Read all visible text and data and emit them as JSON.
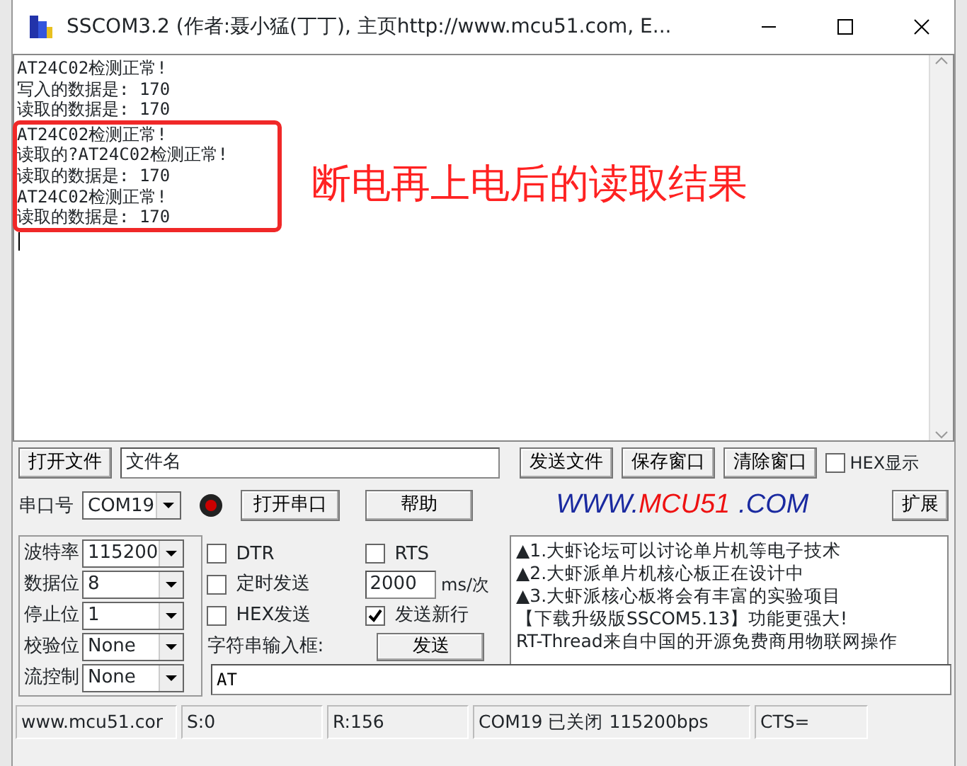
{
  "window": {
    "title": "SSCOM3.2 (作者:聂小猛(丁丁), 主页http://www.mcu51.com,  E..."
  },
  "receive_log": {
    "lines": [
      {
        "text": "AT24C02检测正常!",
        "highlighted": false
      },
      {
        "text": "写入的数据是: 170",
        "highlighted": false
      },
      {
        "text": "读取的数据是: 170",
        "highlighted": false
      },
      {
        "text": "AT24C02检测正常!",
        "highlighted": true
      },
      {
        "text": "读取的?AT24C02检测正常!",
        "highlighted": true
      },
      {
        "text": "读取的数据是: 170",
        "highlighted": true
      },
      {
        "text": "AT24C02检测正常!",
        "highlighted": true
      },
      {
        "text": "读取的数据是: 170",
        "highlighted": true
      }
    ]
  },
  "annotation": {
    "text": "断电再上电后的读取结果"
  },
  "file_row": {
    "open_file_button": "打开文件",
    "file_name": "文件名",
    "send_file_button": "发送文件",
    "save_window_button": "保存窗口",
    "clear_window_button": "清除窗口",
    "hex_display": {
      "label": "HEX显示",
      "checked": false
    }
  },
  "port_row": {
    "port_label": "串口号",
    "port": "COM19",
    "open_port_button": "打开串口",
    "help_button": "帮助",
    "logo": [
      "WWW.",
      "MCU51",
      ".COM"
    ],
    "expand_button": "扩展"
  },
  "settings": [
    {
      "label": "波特率",
      "value": "115200"
    },
    {
      "label": "数据位",
      "value": "8"
    },
    {
      "label": "停止位",
      "value": "1"
    },
    {
      "label": "校验位",
      "value": "None"
    },
    {
      "label": "流控制",
      "value": "None"
    }
  ],
  "options": [
    {
      "kind": "checkbox",
      "label": "DTR",
      "checked": false
    },
    {
      "kind": "checkbox",
      "label": "RTS",
      "checked": false
    },
    {
      "kind": "checkbox",
      "label": "定时发送",
      "checked": false
    },
    {
      "kind": "interval",
      "value": "2000",
      "unit": "ms/次"
    },
    {
      "kind": "checkbox",
      "label": "HEX发送",
      "checked": false
    },
    {
      "kind": "checkbox",
      "label": "发送新行",
      "checked": true
    },
    {
      "kind": "label",
      "label": "字符串输入框:"
    },
    {
      "kind": "button",
      "label": "发送"
    }
  ],
  "send_input": {
    "value": "AT"
  },
  "news": [
    "▲1.大虾论坛可以讨论单片机等电子技术",
    "▲2.大虾派单片机核心板正在设计中",
    "▲3.大虾派核心板将会有丰富的实验项目",
    "【下载升级版SSCOM5.13】功能更强大!",
    "RT-Thread来自中国的开源免费商用物联网操作"
  ],
  "status_bar": [
    "www.mcu51.cor",
    "S:0",
    "R:156",
    "COM19 已关闭  115200bps",
    "CTS="
  ]
}
